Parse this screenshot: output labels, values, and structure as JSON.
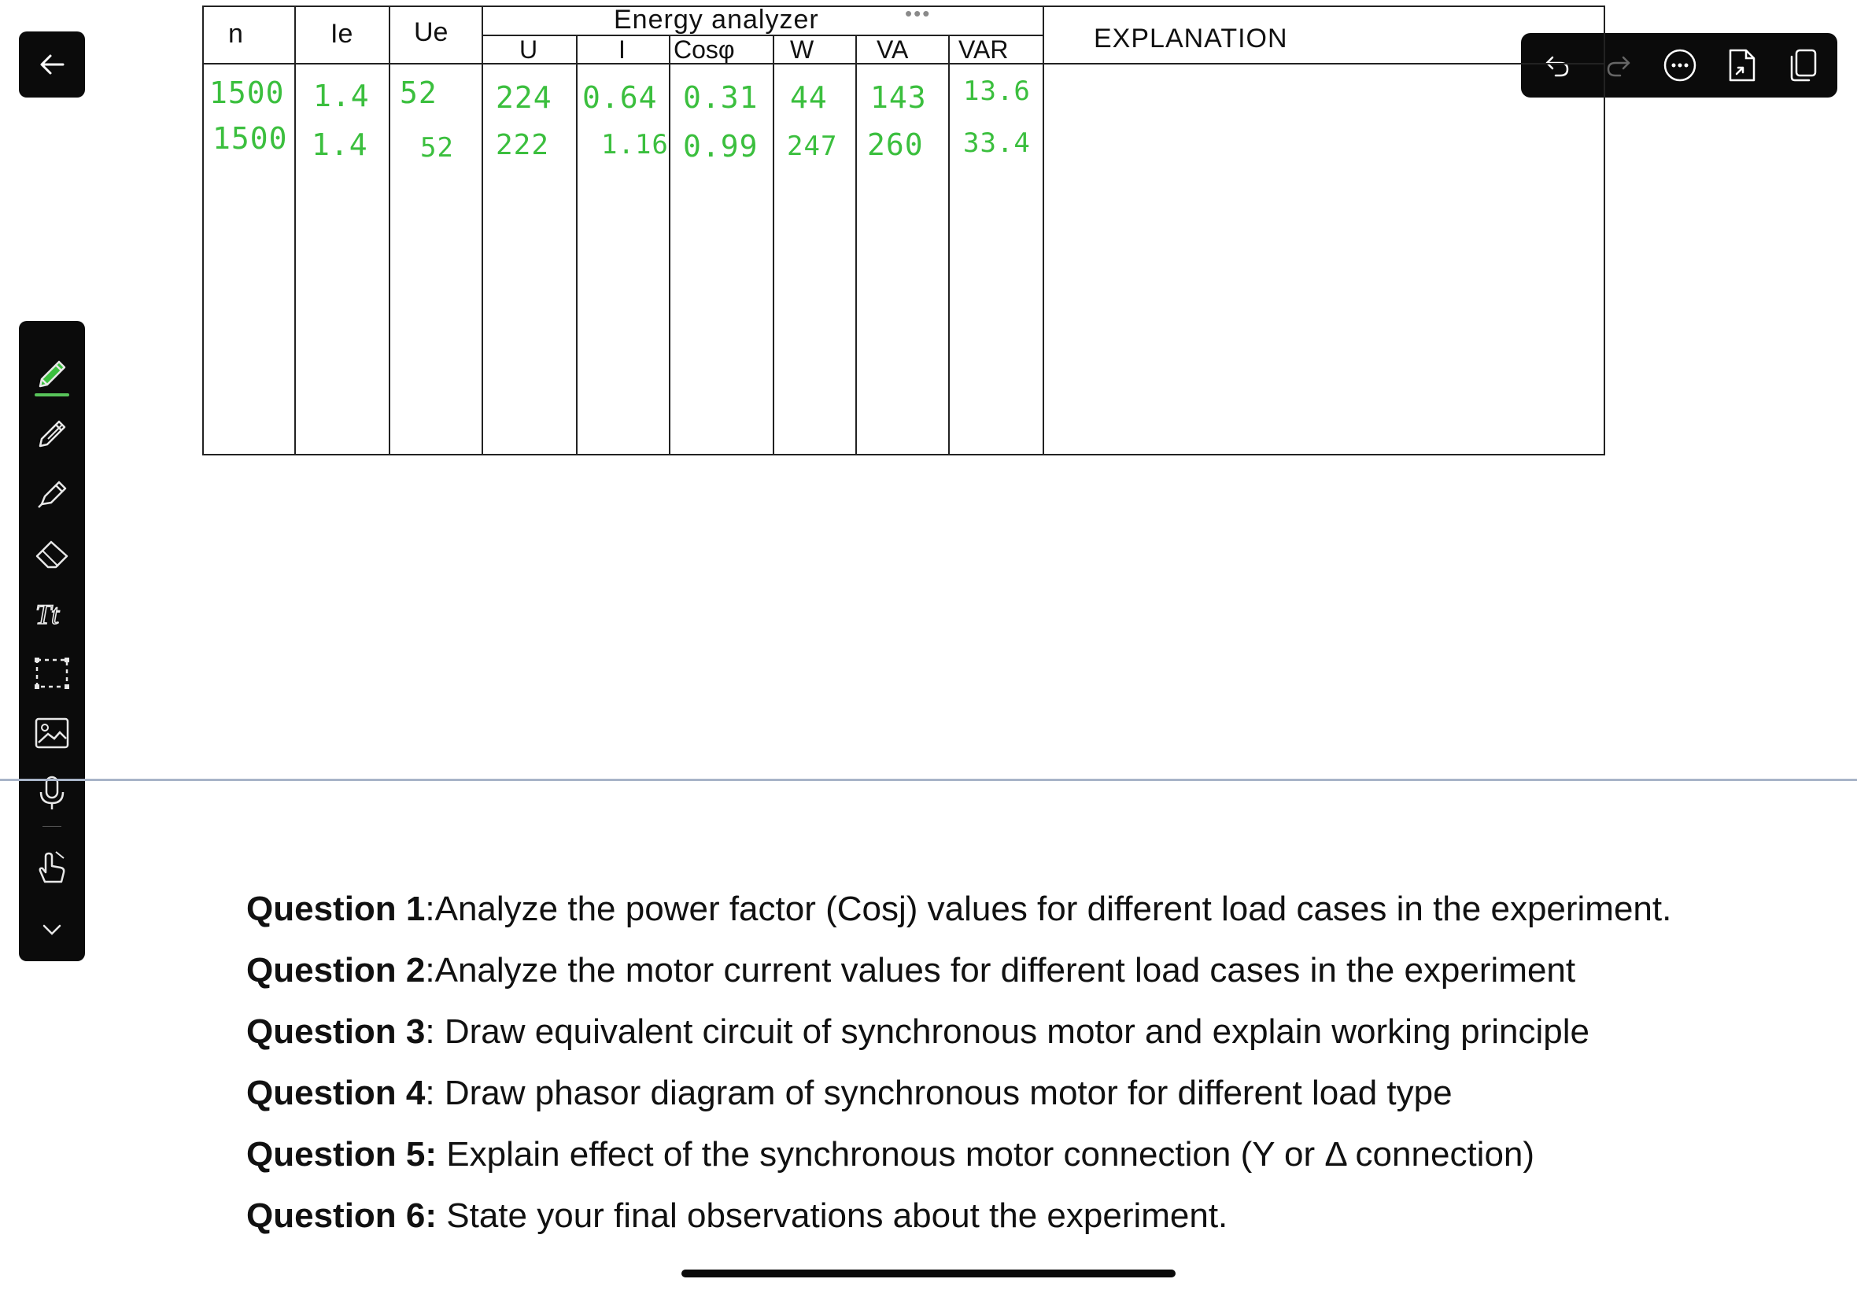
{
  "table": {
    "headers": {
      "n": "n",
      "ie": "Ie",
      "ue": "Ue",
      "group": "Energy analyzer",
      "u": "U",
      "i": "I",
      "cos": "Cosφ",
      "w": "W",
      "va": "VA",
      "var": "VAR",
      "explanation": "EXPLANATION"
    },
    "rows": [
      {
        "n": "1500",
        "ie": "1.4",
        "ue": "52",
        "u": "224",
        "i": "0.64",
        "cos": "0.31",
        "w": "44",
        "va": "143",
        "var": "13.6"
      },
      {
        "n": "1500",
        "ie": "1.4",
        "ue": "52",
        "u": "222",
        "i": "1.16",
        "cos": "0.99",
        "w": "247",
        "va": "260",
        "var": "33.4"
      }
    ]
  },
  "questions": [
    {
      "label": "Question 1",
      "text": ":Analyze the power factor (Cosj) values for different load cases in the experiment."
    },
    {
      "label": "Question 2",
      "text": ":Analyze the motor current values for different load cases in the experiment"
    },
    {
      "label": "Question 3",
      "text": ": Draw equivalent circuit of synchronous motor and explain working principle"
    },
    {
      "label": "Question 4",
      "text": ": Draw phasor diagram of synchronous motor for different load type"
    },
    {
      "label": "Question 5:",
      "text": " Explain effect of the synchronous motor connection (Y or Δ connection)"
    },
    {
      "label": "Question 6:",
      "text": " State your final observations about the experiment."
    }
  ],
  "icons": {
    "back": "arrow-left-icon",
    "tools": [
      "pen-icon",
      "pencil-icon",
      "highlighter-icon",
      "eraser-icon",
      "text-icon",
      "lasso-select-icon",
      "image-icon",
      "microphone-icon",
      "hand-touch-icon",
      "chevron-down-icon"
    ],
    "top_actions": [
      "undo-icon",
      "redo-icon",
      "more-icon",
      "export-icon",
      "pages-icon"
    ]
  },
  "colors": {
    "toolbar_bg": "#0b0b0b",
    "handwriting": "#3bbf3e",
    "active_tool": "#58c45a",
    "divider": "#a8b4c8"
  }
}
